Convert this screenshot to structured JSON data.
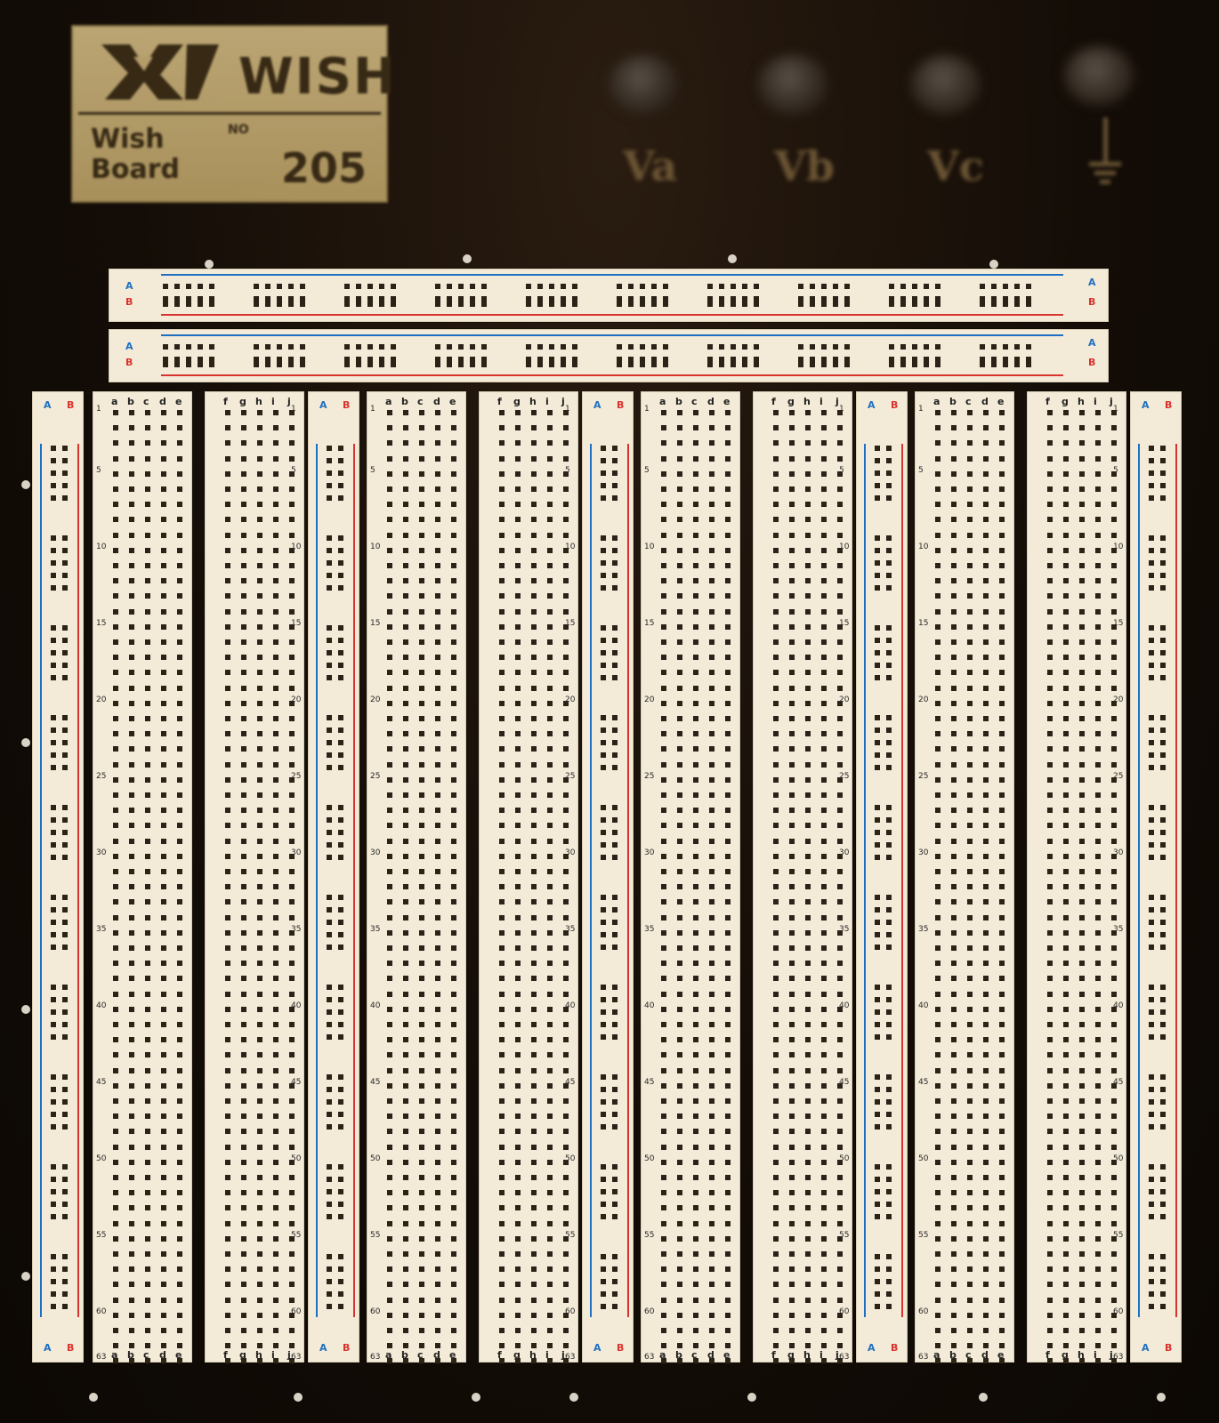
{
  "logo": {
    "brand": "WISH",
    "name_line1": "Wish",
    "name_line2": "Board",
    "small_text": "NO",
    "model": "205"
  },
  "binding_posts": [
    {
      "label": "Va"
    },
    {
      "label": "Vb"
    },
    {
      "label": "Vc"
    },
    {
      "label": "ground-symbol"
    }
  ],
  "rail_labels": {
    "a": "A",
    "b": "B"
  },
  "terminal_columns": {
    "left_letters": [
      "a",
      "b",
      "c",
      "d",
      "e"
    ],
    "right_letters": [
      "f",
      "g",
      "h",
      "i",
      "j"
    ]
  },
  "row_numbers": [
    "1",
    "5",
    "10",
    "15",
    "20",
    "25",
    "30",
    "35",
    "40",
    "45",
    "50",
    "55",
    "60",
    "63"
  ],
  "colors": {
    "blue_line": "#1f6fc2",
    "red_line": "#d8342f",
    "plastic": "#f3ead7",
    "hole": "#2c2318",
    "backplate": "#160f08",
    "logo_plate": "#c2aa74"
  },
  "icons": [
    "wish-logo-icon",
    "ground-icon"
  ]
}
